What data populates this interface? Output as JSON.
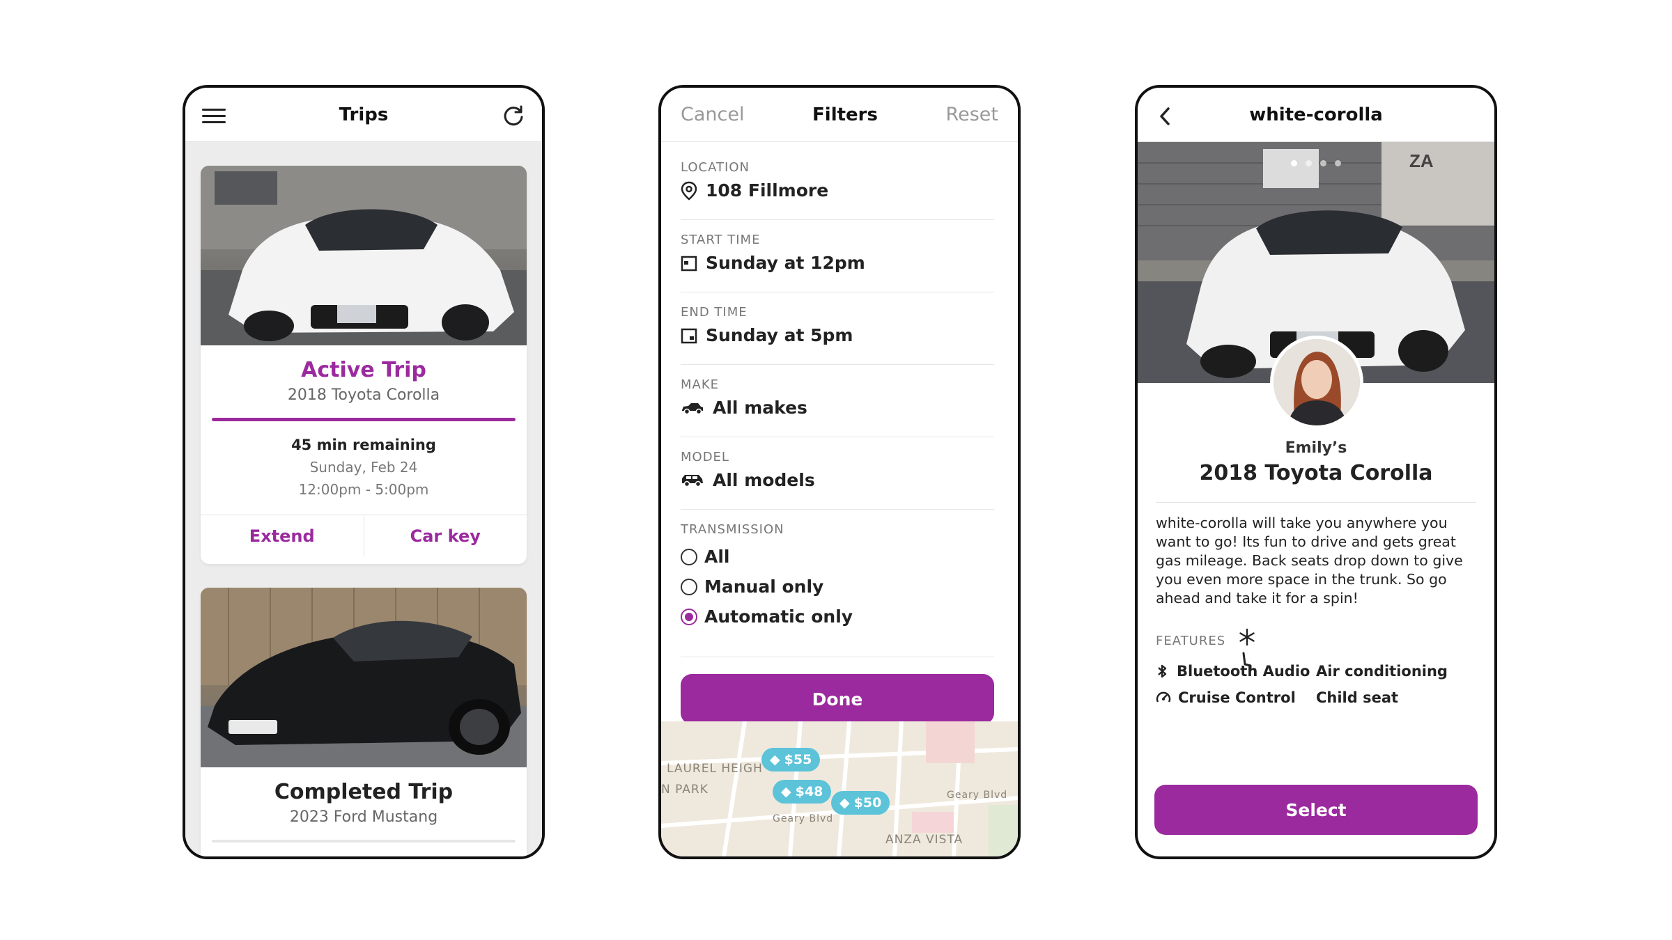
{
  "colors": {
    "accent": "#9b2a9e",
    "map_pin": "#5cc3d9",
    "muted_text": "#777777"
  },
  "trips_screen": {
    "title": "Trips",
    "menu_icon": "hamburger-menu-icon",
    "refresh_icon": "refresh-icon",
    "active_trip": {
      "status": "Active Trip",
      "car": "2018 Toyota Corolla",
      "progress": 1.0,
      "remaining": "45 min remaining",
      "date": "Sunday, Feb 24",
      "time": "12:00pm - 5:00pm",
      "extend_label": "Extend",
      "car_key_label": "Car key"
    },
    "completed_trip": {
      "status": "Completed Trip",
      "car": "2023 Ford Mustang"
    }
  },
  "filters_screen": {
    "cancel_label": "Cancel",
    "title": "Filters",
    "reset_label": "Reset",
    "location": {
      "label": "LOCATION",
      "value": "108 Fillmore",
      "icon": "location-pin-icon"
    },
    "start_time": {
      "label": "START TIME",
      "value": "Sunday at 12pm",
      "icon": "calendar-icon"
    },
    "end_time": {
      "label": "END TIME",
      "value": "Sunday at 5pm",
      "icon": "calendar-icon"
    },
    "make": {
      "label": "MAKE",
      "value": "All makes",
      "icon": "sedan-icon"
    },
    "model": {
      "label": "MODEL",
      "value": "All models",
      "icon": "suv-icon"
    },
    "transmission": {
      "label": "TRANSMISSION",
      "options": [
        "All",
        "Manual only",
        "Automatic only"
      ],
      "selected": "Automatic only"
    },
    "done_label": "Done",
    "map": {
      "pins": [
        "$55",
        "$48",
        "$50"
      ],
      "labels": [
        "LAUREL HEIGH",
        "N PARK",
        "ANZA VISTA",
        "Geary Blvd",
        "Geary Blvd"
      ]
    }
  },
  "detail_screen": {
    "title": "white-corolla",
    "back_icon": "chevron-left-icon",
    "owner": "Emily’s",
    "model": "2018 Toyota Corolla",
    "description": "white-corolla will take you anywhere you want to go! Its fun to drive and gets great gas mileage.  Back seats drop down to give you even more space in the trunk. So go ahead and take it for a spin!",
    "features_label": "FEATURES",
    "features": [
      {
        "label": "Bluetooth Audio",
        "icon": "bluetooth-audio-icon"
      },
      {
        "label": "Air conditioning",
        "icon": "snowflake-icon"
      },
      {
        "label": "Cruise Control",
        "icon": "cruise-control-icon"
      },
      {
        "label": "Child seat",
        "icon": "child-seat-icon"
      }
    ],
    "select_label": "Select"
  }
}
